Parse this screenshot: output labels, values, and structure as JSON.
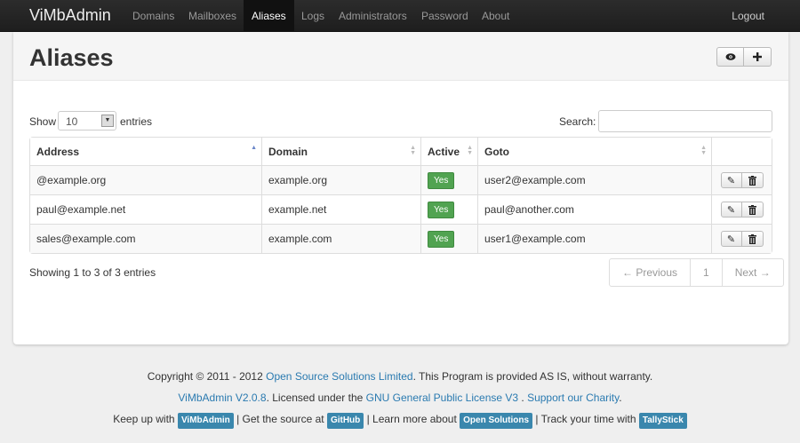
{
  "app": {
    "brand": "ViMbAdmin",
    "nav": [
      "Domains",
      "Mailboxes",
      "Aliases",
      "Logs",
      "Administrators",
      "Password",
      "About"
    ],
    "logout": "Logout"
  },
  "page": {
    "title": "Aliases",
    "toolbar": {
      "view_icon": "eye-icon",
      "add_icon": "plus-icon"
    }
  },
  "controls": {
    "show_label": "Show",
    "length_value": "10",
    "entries_label": "entries",
    "search_label": "Search:",
    "search_value": ""
  },
  "table": {
    "headers": [
      "Address",
      "Domain",
      "Active",
      "Goto"
    ],
    "rows": [
      {
        "address": "@example.org",
        "domain": "example.org",
        "active": "Yes",
        "goto": "user2@example.com"
      },
      {
        "address": "paul@example.net",
        "domain": "example.net",
        "active": "Yes",
        "goto": "paul@another.com"
      },
      {
        "address": "sales@example.com",
        "domain": "example.com",
        "active": "Yes",
        "goto": "user1@example.com"
      }
    ]
  },
  "info": "Showing 1 to 3 of 3 entries",
  "pagination": {
    "previous": "← Previous",
    "page": "1",
    "next": "Next →"
  },
  "footer": {
    "line1_a": "Copyright © 2011 - 2012 ",
    "line1_link": "Open Source Solutions Limited",
    "line1_b": ". This Program is provided AS IS, without warranty.",
    "line2_link1": "ViMbAdmin V2.0.8",
    "line2_a": ". Licensed under the ",
    "line2_link2": "GNU General Public License V3",
    "line2_b": " . ",
    "line2_link3": "Support our Charity",
    "line2_c": ".",
    "line3_a": "Keep up with ",
    "tag1": "ViMbAdmin",
    "line3_b": " |  Get the source at ",
    "tag2": "GitHub",
    "line3_c": " |  Learn more about ",
    "tag3": "Open Solutions",
    "line3_d": " |  Track your time with ",
    "tag4": "TallyStick"
  },
  "colors": {
    "navbar": "#1e1e1e",
    "active_badge": "#51a351",
    "link": "#2a7ab0",
    "tag": "#3a87ad"
  }
}
